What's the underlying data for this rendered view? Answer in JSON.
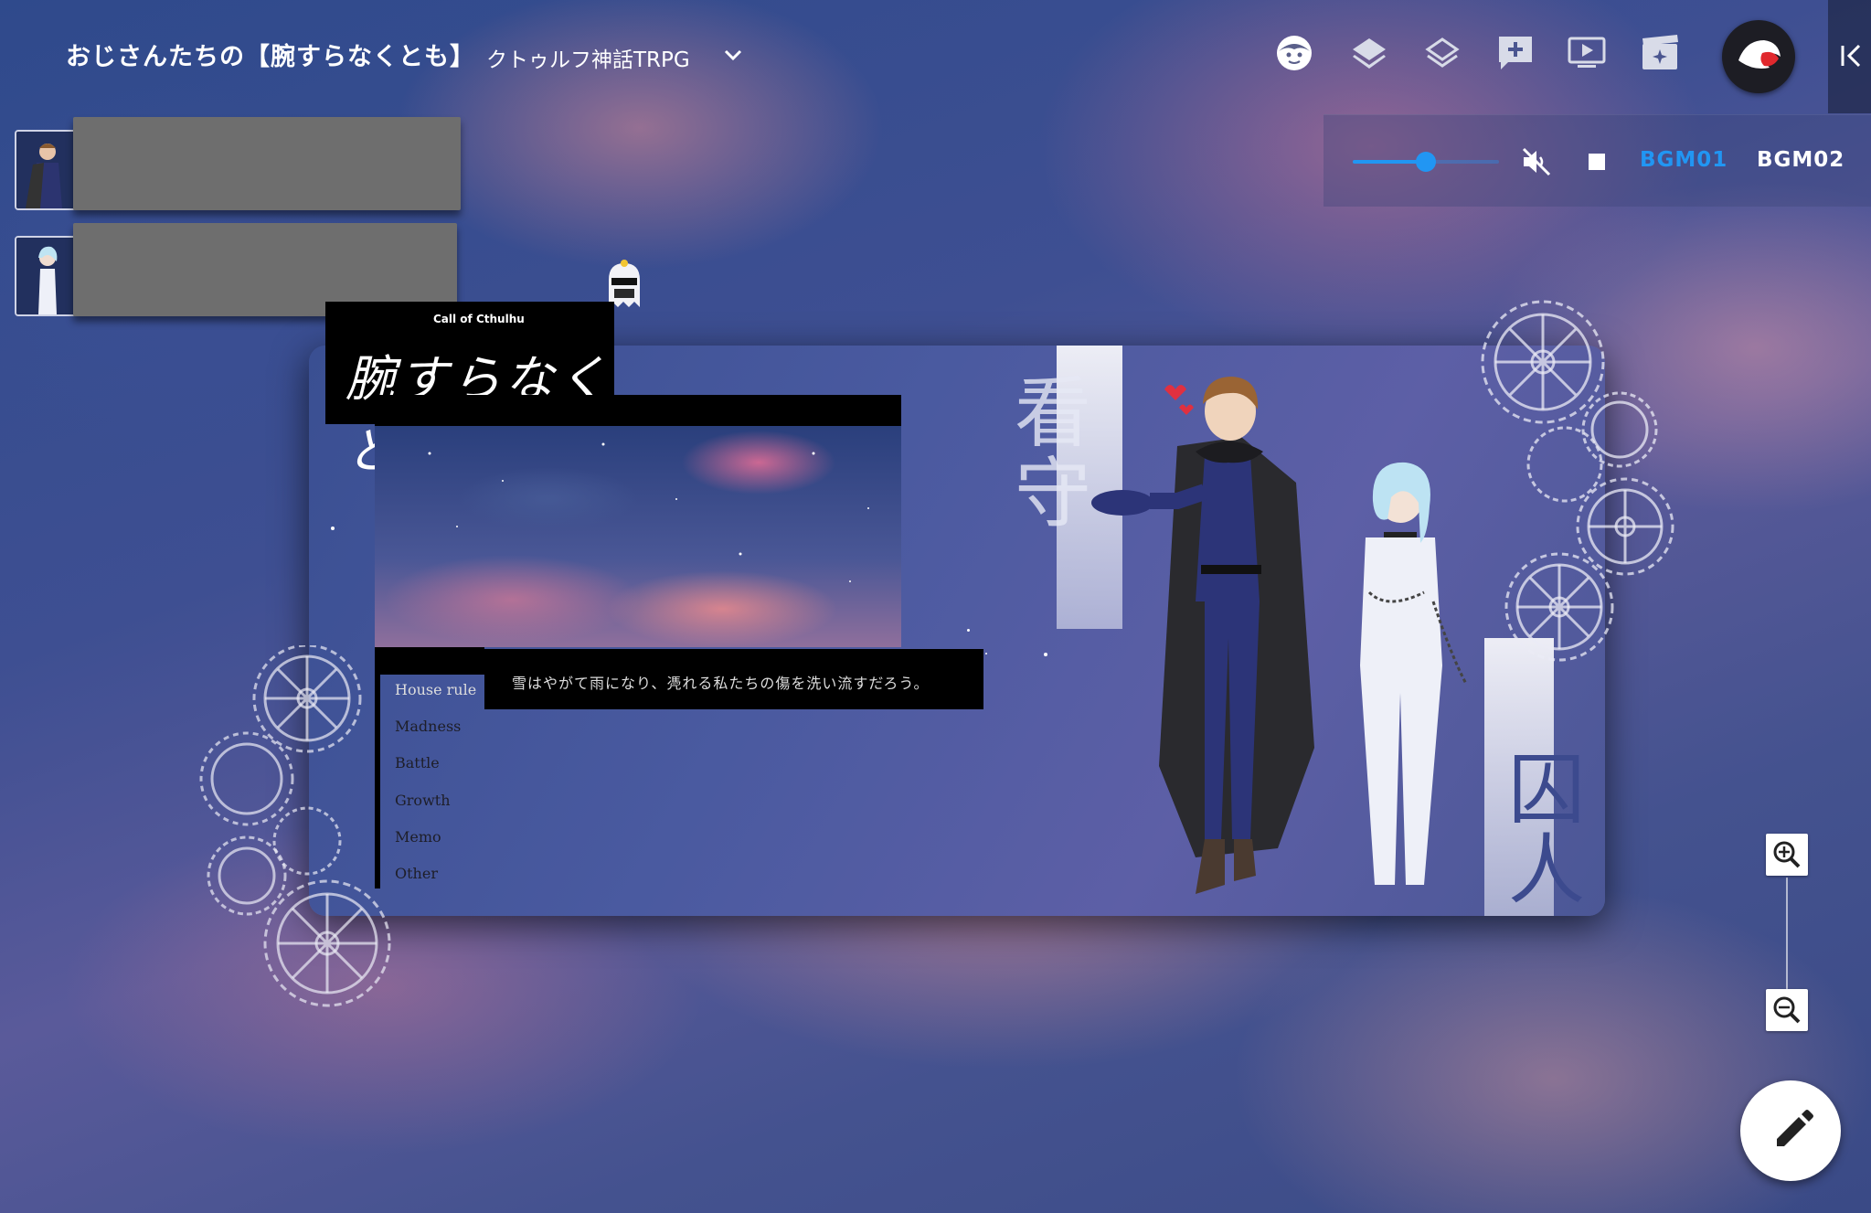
{
  "header": {
    "title": "おじさんたちの【腕すらなくとも】",
    "subtitle": "クトゥルフ神話TRPG"
  },
  "toolbar": {
    "icons": [
      "character-icon",
      "layers-filled-icon",
      "layers-outline-icon",
      "add-chat-icon",
      "screen-play-icon",
      "scene-effects-icon"
    ]
  },
  "bgm": {
    "volume": 0.5,
    "muted": true,
    "tabs": [
      {
        "label": "BGM01",
        "active": true
      },
      {
        "label": "BGM02",
        "active": false
      }
    ],
    "active_color": "#2196f3"
  },
  "board": {
    "logo_small": "Call of Cthulhu",
    "logo_title": "腕すらなくとも.",
    "quote": "雪はやがて雨になり、凴れる私たちの傷を洗い流すだろう。",
    "menu": [
      "House rule",
      "Madness",
      "Battle",
      "Growth",
      "Memo",
      "Other"
    ],
    "label_guard": "看守",
    "label_prisoner": "囚人"
  },
  "colors": {
    "accent": "#2196f3",
    "board": "#4a5aa0"
  }
}
